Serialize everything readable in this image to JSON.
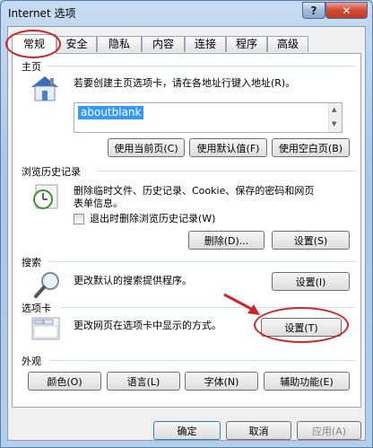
{
  "window": {
    "title": "Internet 选项",
    "help": "?",
    "close": "✕"
  },
  "tabs": [
    "常规",
    "安全",
    "隐私",
    "内容",
    "连接",
    "程序",
    "高级"
  ],
  "home": {
    "label": "主页",
    "description": "若要创建主页选项卡，请在各地址行键入地址(R)。",
    "url": "aboutblank",
    "buttons": [
      "使用当前页(C)",
      "使用默认值(F)",
      "使用空白页(B)"
    ]
  },
  "history": {
    "label": "浏览历史记录",
    "description_line1": "删除临时文件、历史记录、Cookie、保存的密码和网页",
    "description_line2": "表单信息。",
    "checkbox_label": "退出时删除浏览历史记录(W)",
    "delete_button": "删除(D)...",
    "settings_button": "设置(S)"
  },
  "search": {
    "label": "搜索",
    "description": "更改默认的搜索提供程序。",
    "settings_button": "设置(I)"
  },
  "tabs_group": {
    "label": "选项卡",
    "description": "更改网页在选项卡中显示的方式。",
    "settings_button": "设置(T)"
  },
  "appearance": {
    "label": "外观",
    "buttons": [
      "颜色(O)",
      "语言(L)",
      "字体(N)",
      "辅助功能(E)"
    ]
  },
  "footer": {
    "ok": "确定",
    "cancel": "取消",
    "apply": "应用(A)"
  },
  "colors": {
    "highlight": "#c8262a",
    "selection": "#3399ff"
  }
}
